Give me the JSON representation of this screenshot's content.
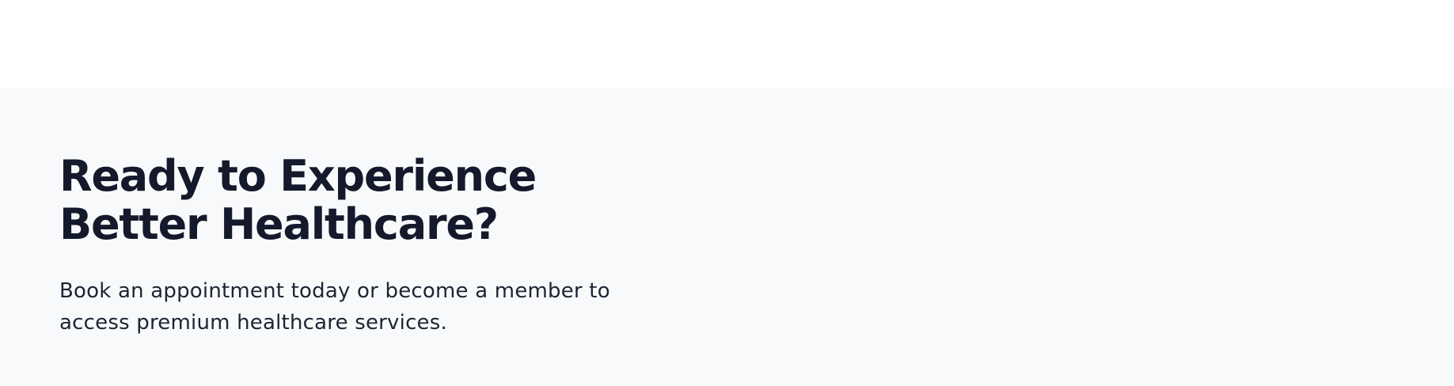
{
  "cta": {
    "title": "Ready to Experience Better Healthcare?",
    "description": "Book an appointment today or become a member to access premium healthcare services."
  },
  "colors": {
    "section_background": "#f8f9fb",
    "heading": "#141a2b",
    "body_text": "#1f2433"
  }
}
